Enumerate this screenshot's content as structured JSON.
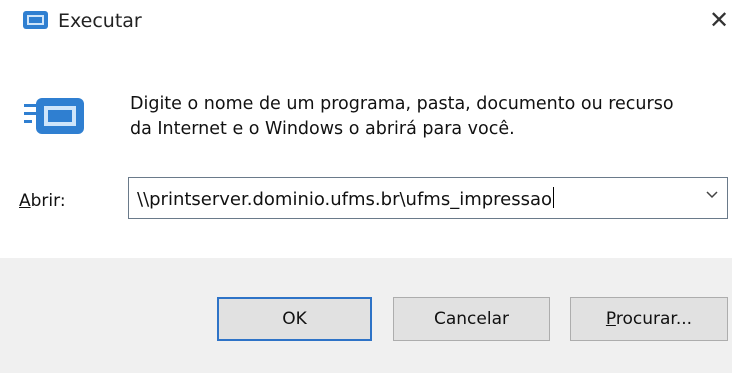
{
  "window": {
    "title": "Executar",
    "close_glyph": "✕",
    "icon": "run-icon"
  },
  "content": {
    "icon": "run-dialog-icon",
    "message": "Digite o nome de um programa, pasta, documento ou recurso da Internet e o Windows o abrirá para você."
  },
  "open_field": {
    "label_mnemonic": "A",
    "label_rest": "brir:",
    "value": "\\\\printserver.dominio.ufms.br\\ufms_impressao"
  },
  "buttons": {
    "ok": "OK",
    "cancel": "Cancelar",
    "browse_mnemonic": "P",
    "browse_rest": "rocurar..."
  },
  "colors": {
    "accent": "#2e73c7",
    "footer_bg": "#f0f0f0"
  }
}
